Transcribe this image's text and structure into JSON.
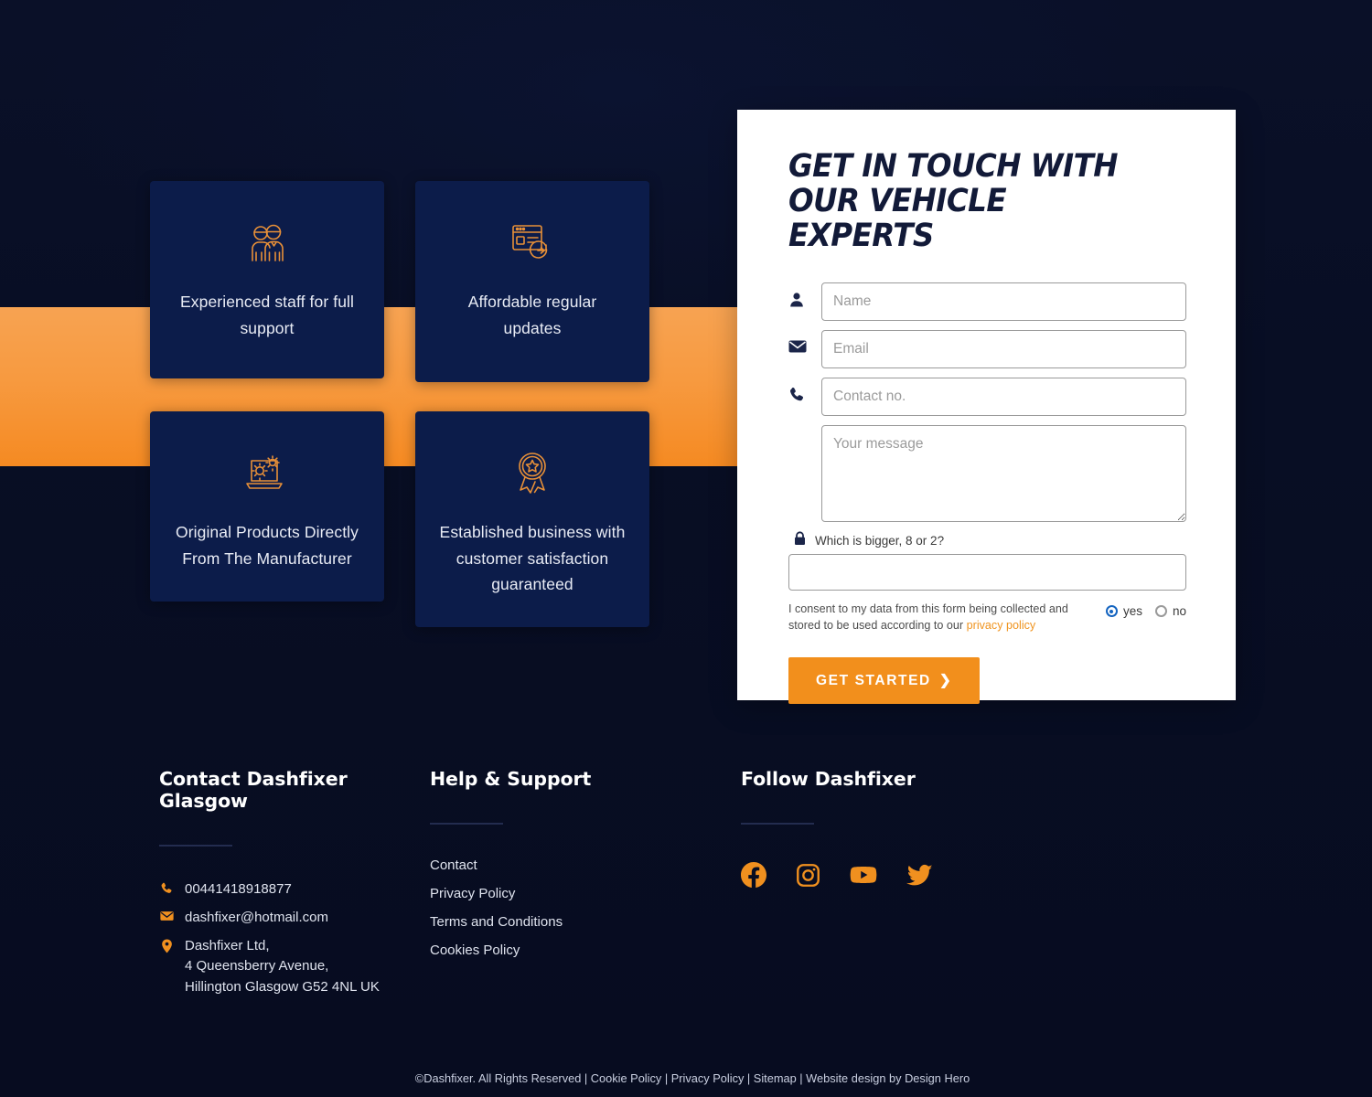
{
  "theme": {
    "page_bg": "#0a1028",
    "card_bg": "#0c1c4a",
    "accent_orange": "#f28f1c",
    "band_orange": "#f79a40",
    "text_light": "#e9ecf5"
  },
  "features": [
    {
      "icon": "two-people-icon",
      "text": "Experienced staff for full support"
    },
    {
      "icon": "browser-refresh-icon",
      "text": "Affordable regular updates"
    },
    {
      "icon": "laptop-gears-icon",
      "text": "Original Products Directly From The Manufacturer"
    },
    {
      "icon": "award-ribbon-icon",
      "text": "Established business with customer satisfaction guaranteed"
    }
  ],
  "form": {
    "title": "GET IN TOUCH WITH OUR VEHICLE EXPERTS",
    "fields": {
      "name": {
        "icon": "user-icon",
        "placeholder": "Name",
        "value": ""
      },
      "email": {
        "icon": "envelope-icon",
        "placeholder": "Email",
        "value": ""
      },
      "phone": {
        "icon": "phone-icon",
        "placeholder": "Contact no.",
        "value": ""
      },
      "message": {
        "placeholder": "Your message",
        "value": ""
      }
    },
    "captcha": {
      "icon": "lock-icon",
      "label": "Which is bigger, 8 or 2?",
      "value": ""
    },
    "consent": {
      "text": "I consent to my data from this form being collected and stored to be used according to our",
      "link_label": "privacy policy",
      "options": [
        {
          "label": "yes",
          "selected": true
        },
        {
          "label": "no",
          "selected": false
        }
      ]
    },
    "submit_label": "GET STARTED",
    "submit_chevron": "❯"
  },
  "footer": {
    "contact": {
      "heading": "Contact Dashfixer Glasgow",
      "items": [
        {
          "icon": "phone-icon",
          "text": "00441418918877"
        },
        {
          "icon": "envelope-icon",
          "text": "dashfixer@hotmail.com"
        },
        {
          "icon": "map-pin-icon",
          "text": "Dashfixer Ltd,\n4 Queensberry Avenue,\nHillington Glasgow G52 4NL UK"
        }
      ]
    },
    "help": {
      "heading": "Help & Support",
      "links": [
        "Contact",
        "Privacy Policy",
        "Terms and Conditions",
        "Cookies Policy"
      ]
    },
    "follow": {
      "heading": "Follow Dashfixer",
      "socials": [
        "facebook-icon",
        "instagram-icon",
        "youtube-icon",
        "twitter-icon"
      ]
    },
    "copyright": "©Dashfixer. All Rights Reserved | Cookie Policy | Privacy Policy | Sitemap | Website design by Design Hero"
  }
}
